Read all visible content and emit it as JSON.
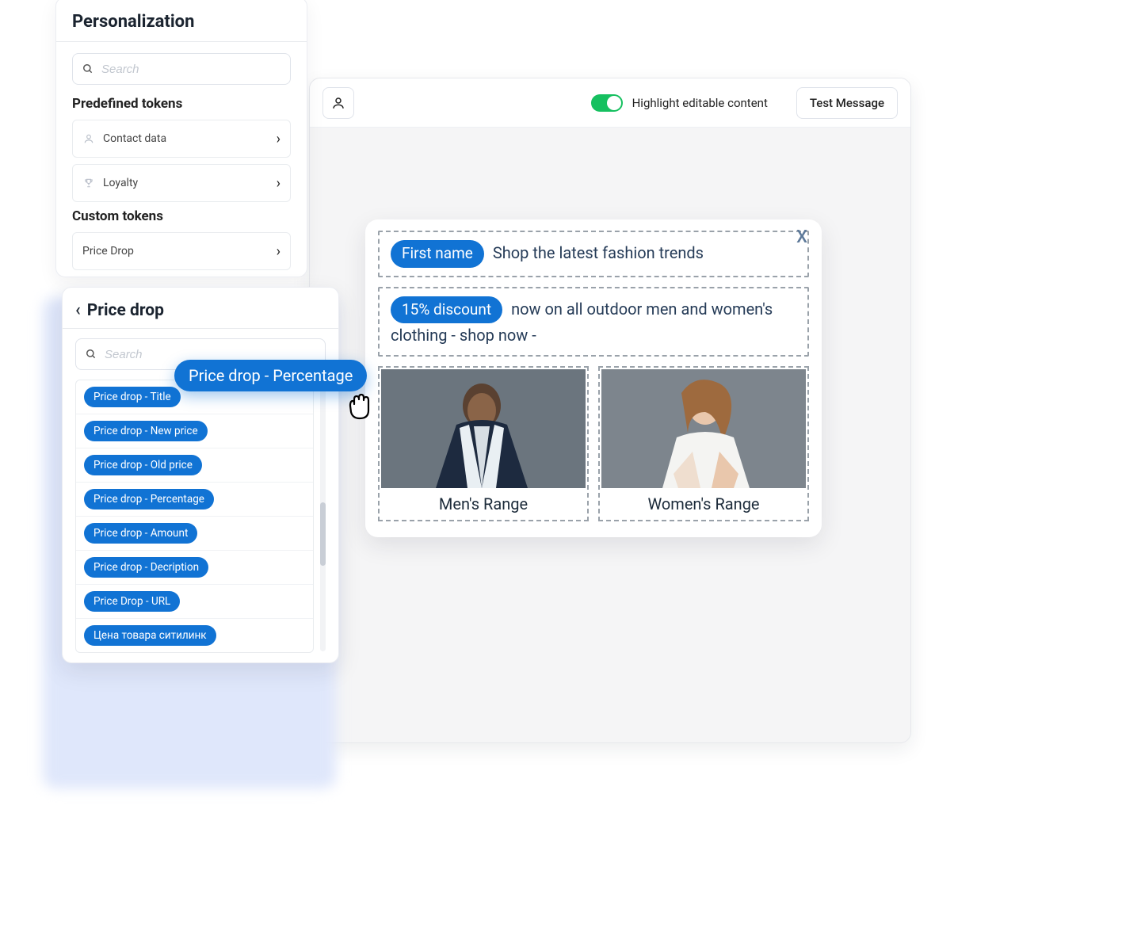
{
  "editor": {
    "toggle_label": "Highlight editable content",
    "test_button": "Test Message"
  },
  "preview": {
    "close_label": "X",
    "headline_token": "First name",
    "headline_text": "Shop the latest fashion trends",
    "body_token": "15% discount",
    "body_text": " now on all outdoor men and women's clothing - shop now -",
    "cols": [
      {
        "caption": "Men's Range"
      },
      {
        "caption": "Women's Range"
      }
    ]
  },
  "panel": {
    "title": "Personalization",
    "search_placeholder": "Search",
    "section_predefined": "Predefined tokens",
    "predefined": [
      {
        "label": "Contact data"
      },
      {
        "label": "Loyalty"
      }
    ],
    "section_custom": "Custom tokens",
    "custom": [
      {
        "label": "Price Drop"
      }
    ]
  },
  "subpanel": {
    "title": "Price drop",
    "search_placeholder": "Search",
    "items": [
      "Price drop - Title",
      "Price drop - New price",
      "Price drop - Old price",
      "Price drop - Percentage",
      "Price drop - Amount",
      "Price drop - Decription",
      "Price Drop - URL",
      "Цена товара ситилинк"
    ]
  },
  "drag": {
    "label": "Price drop - Percentage"
  }
}
